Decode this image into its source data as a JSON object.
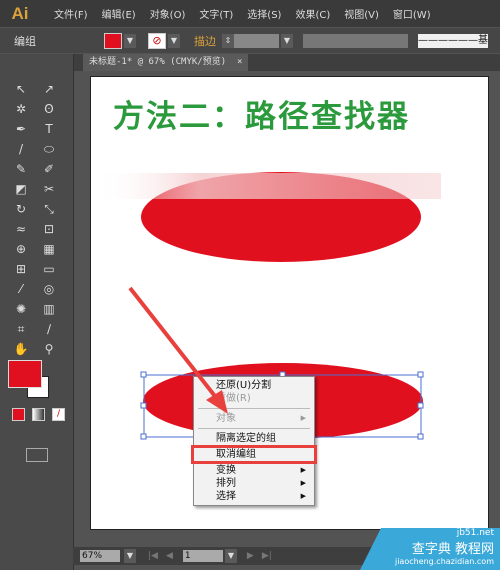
{
  "app": {
    "logo": "Ai"
  },
  "menu": [
    "文件(F)",
    "编辑(E)",
    "对象(O)",
    "文字(T)",
    "选择(S)",
    "效果(C)",
    "视图(V)",
    "窗口(W)"
  ],
  "control_bar": {
    "selection_label": "编组",
    "fill_color": "#e01020",
    "stroke_label": "描边",
    "stroke_style_label": "基本"
  },
  "document_tab": {
    "title": "未标题-1* @ 67% (CMYK/预览)",
    "close": "×"
  },
  "artboard": {
    "heading": "方法二：路径查找器",
    "shape_color": "#e0101e"
  },
  "context_menu": {
    "items": [
      {
        "label": "还原(U)分割",
        "disabled": false
      },
      {
        "label": "重做(R)",
        "disabled": true
      },
      {
        "label": "对象",
        "disabled": true,
        "submenu": true
      },
      {
        "label": "隔离选定的组",
        "disabled": false
      },
      {
        "label": "取消编组",
        "disabled": false,
        "highlighted": true
      },
      {
        "label": "变换",
        "submenu": true
      },
      {
        "label": "排列",
        "submenu": true
      },
      {
        "label": "选择",
        "submenu": true
      }
    ]
  },
  "status_bar": {
    "zoom": "67%",
    "page": "1"
  },
  "watermark": {
    "site": "jb51.net",
    "name": "查字典 教程网",
    "url": "jiaocheng.chazidian.com"
  },
  "annotation_color": "#e8413d"
}
